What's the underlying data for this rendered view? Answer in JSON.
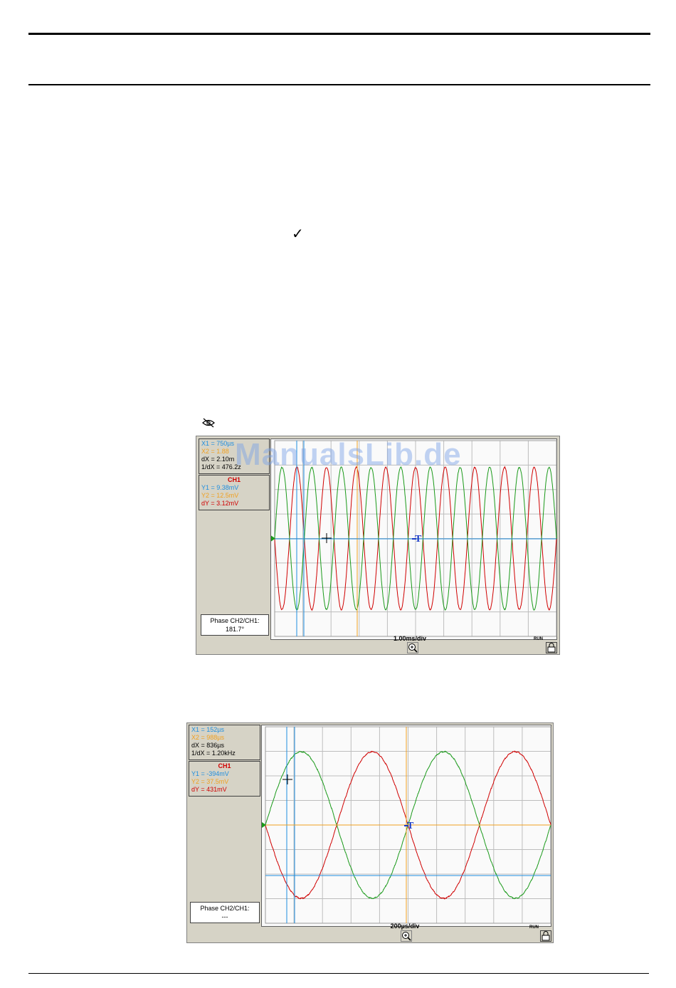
{
  "page": {
    "checkmark": "✓"
  },
  "watermark": {
    "text": "ManualsLib.de"
  },
  "scope1": {
    "cursor_info": {
      "x1": "X1 = 750µs",
      "x2": "X2 = 1.88",
      "dx": "dX = 2.10m",
      "inv_dx": "1/dX = 476.2z"
    },
    "channel": {
      "title": "CH1",
      "y1": "Y1 = 9.38mV",
      "y2": "Y2 = 12.5mV",
      "dy": "dY = 3.12mV"
    },
    "phase": {
      "label": "Phase CH2/CH1:",
      "value": "181.7°"
    },
    "timebase": "1.00ms/div",
    "run_label": "RUN",
    "colors": {
      "ch1": "#d00000",
      "ch2": "#1a9a1a",
      "cursor_x1": "#1e8ee0",
      "cursor_x2": "#f0a020",
      "trigger": "#1a3ac8"
    },
    "chart_data": {
      "type": "line",
      "series": [
        {
          "name": "CH1",
          "color": "#d00000",
          "cycles": 9.5,
          "phase": 3.1416
        },
        {
          "name": "CH2",
          "color": "#1a9a1a",
          "cycles": 9.5,
          "phase": 0
        }
      ]
    }
  },
  "scope2": {
    "cursor_info": {
      "x1": "X1 = 152µs",
      "x2": "X2 = 988µs",
      "dx": "dX = 836µs",
      "inv_dx": "1/dX = 1.20kHz"
    },
    "channel": {
      "title": "CH1",
      "y1": "Y1 = -394mV",
      "y2": "Y2 = 37.5mV",
      "dy": "dY = 431mV"
    },
    "phase": {
      "label": "Phase CH2/CH1:",
      "value": "---"
    },
    "timebase": "200µs/div",
    "run_label": "RUN",
    "colors": {
      "ch1": "#d00000",
      "ch2": "#1a9a1a",
      "cursor_x1": "#1e8ee0",
      "cursor_x2": "#f0a020",
      "trigger": "#1a3ac8"
    },
    "chart_data": {
      "type": "line",
      "series": [
        {
          "name": "CH1",
          "color": "#d00000",
          "cycles": 2,
          "phase": 3.1416
        },
        {
          "name": "CH2",
          "color": "#1a9a1a",
          "cycles": 2,
          "phase": 0
        }
      ]
    }
  }
}
